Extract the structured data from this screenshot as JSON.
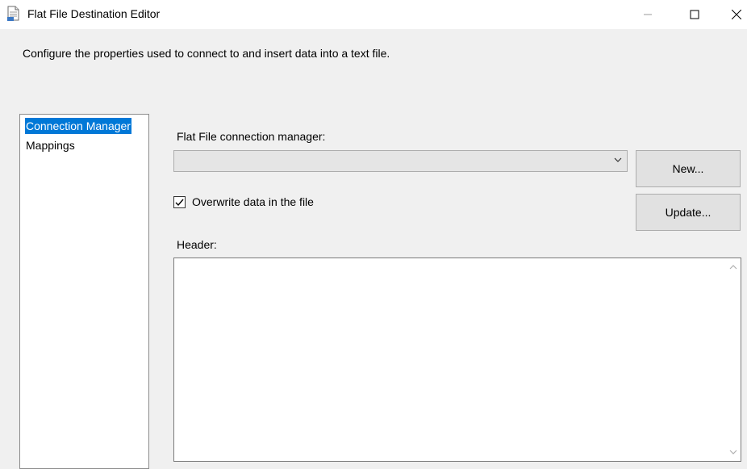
{
  "window": {
    "title": "Flat File Destination Editor",
    "icon": "flat-file-document-icon",
    "controls": [
      "minimize-icon",
      "maximize-icon",
      "close-icon"
    ]
  },
  "description": "Configure the properties used to connect to and insert data into a text file.",
  "nav": {
    "items": [
      {
        "label": "Connection Manager",
        "selected": true
      },
      {
        "label": "Mappings",
        "selected": false
      }
    ],
    "selected_color": "#0078d7"
  },
  "connection": {
    "label": "Flat File connection manager:",
    "selected_value": "",
    "new_button": "New...",
    "update_button": "Update..."
  },
  "overwrite": {
    "label": "Overwrite data in the file",
    "checked": true
  },
  "header": {
    "label": "Header:",
    "value": ""
  }
}
